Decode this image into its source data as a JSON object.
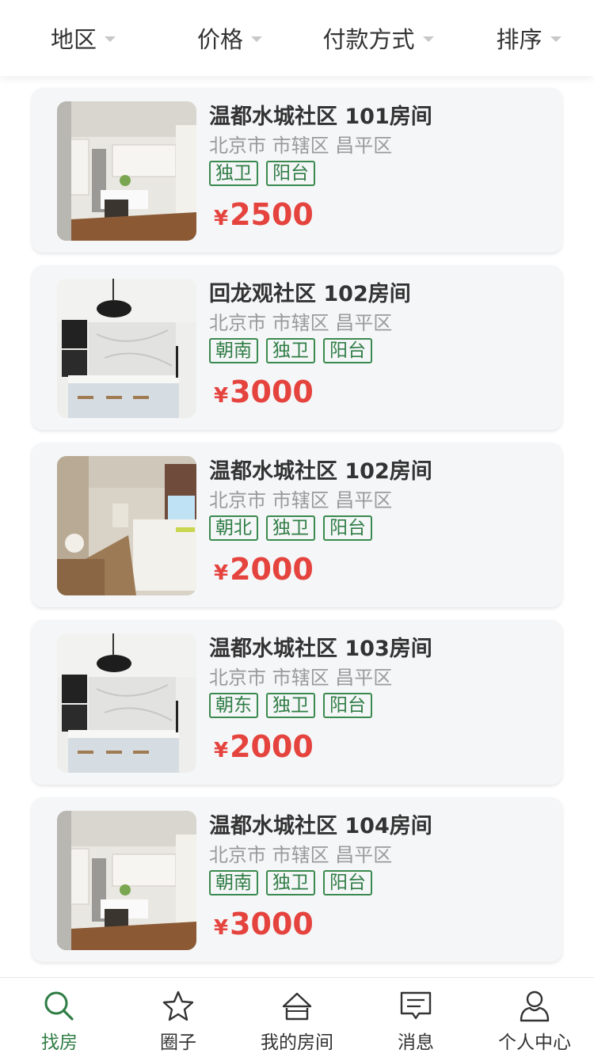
{
  "filters": [
    {
      "label": "地区"
    },
    {
      "label": "价格"
    },
    {
      "label": "付款方式"
    },
    {
      "label": "排序"
    }
  ],
  "currency_symbol": "¥",
  "listings": [
    {
      "title": "温都水城社区 101房间",
      "address": "北京市 市辖区 昌平区",
      "tags": [
        "独卫",
        "阳台"
      ],
      "price": "2500",
      "image": "kitchen-warm-wood-floor"
    },
    {
      "title": "回龙观社区 102房间",
      "address": "北京市 市辖区 昌平区",
      "tags": [
        "朝南",
        "独卫",
        "阳台"
      ],
      "price": "3000",
      "image": "kitchen-white-marble"
    },
    {
      "title": "温都水城社区 102房间",
      "address": "北京市 市辖区 昌平区",
      "tags": [
        "朝北",
        "独卫",
        "阳台"
      ],
      "price": "2000",
      "image": "kitchen-galley-window"
    },
    {
      "title": "温都水城社区 103房间",
      "address": "北京市 市辖区 昌平区",
      "tags": [
        "朝东",
        "独卫",
        "阳台"
      ],
      "price": "2000",
      "image": "kitchen-white-marble"
    },
    {
      "title": "温都水城社区 104房间",
      "address": "北京市 市辖区 昌平区",
      "tags": [
        "朝南",
        "独卫",
        "阳台"
      ],
      "price": "3000",
      "image": "kitchen-warm-wood-floor"
    }
  ],
  "tabs": [
    {
      "label": "找房",
      "icon": "search-icon",
      "active": true
    },
    {
      "label": "圈子",
      "icon": "star-icon",
      "active": false
    },
    {
      "label": "我的房间",
      "icon": "home-icon",
      "active": false
    },
    {
      "label": "消息",
      "icon": "message-icon",
      "active": false
    },
    {
      "label": "个人中心",
      "icon": "user-icon",
      "active": false
    }
  ],
  "colors": {
    "accent_green": "#2f7d45",
    "price_red": "#e5433d",
    "card_bg": "#f5f6f8"
  }
}
